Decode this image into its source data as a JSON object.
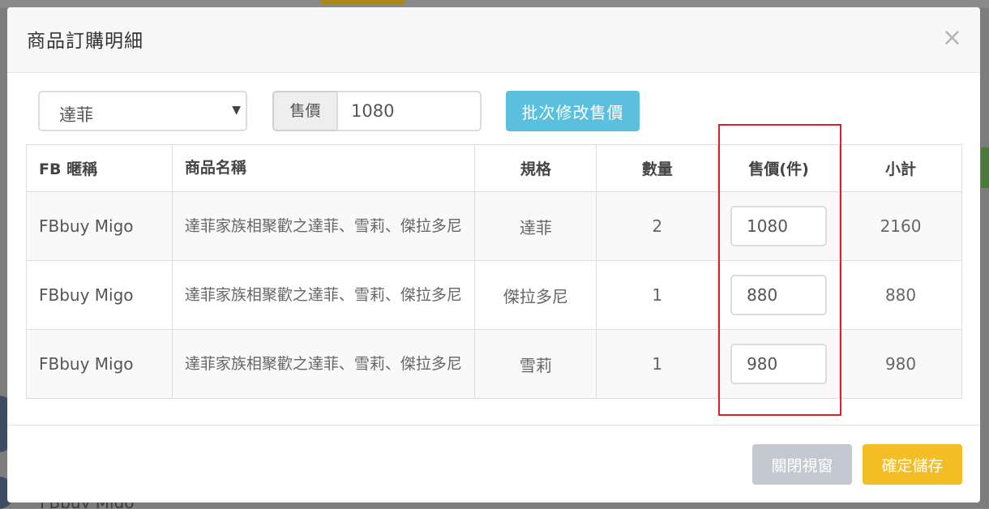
{
  "modal": {
    "title": "商品訂購明細",
    "close_icon": "×"
  },
  "toolbar": {
    "select_value": "達菲",
    "select_caret": "▼",
    "price_label": "售價",
    "price_value": "1080",
    "batch_button": "批次修改售價"
  },
  "table": {
    "headers": {
      "fb": "FB 暱稱",
      "name": "商品名稱",
      "spec": "規格",
      "qty": "數量",
      "price": "售價(件)",
      "subtotal": "小計"
    },
    "rows": [
      {
        "fb": "FBbuy Migo",
        "name": "達菲家族相聚歡之達菲、雪莉、傑拉多尼",
        "spec": "達菲",
        "qty": "2",
        "price": "1080",
        "subtotal": "2160"
      },
      {
        "fb": "FBbuy Migo",
        "name": "達菲家族相聚歡之達菲、雪莉、傑拉多尼",
        "spec": "傑拉多尼",
        "qty": "1",
        "price": "880",
        "subtotal": "880"
      },
      {
        "fb": "FBbuy Migo",
        "name": "達菲家族相聚歡之達菲、雪莉、傑拉多尼",
        "spec": "雪莉",
        "qty": "1",
        "price": "980",
        "subtotal": "980"
      }
    ]
  },
  "footer": {
    "close_button": "關閉視窗",
    "save_button": "確定儲存"
  },
  "background": {
    "row_fb": "FBbuy Migo"
  },
  "colors": {
    "batch_button": "#5bc0de",
    "save_button": "#f3be25",
    "close_button": "#c4c9d1",
    "highlight_border": "#d9212a"
  }
}
